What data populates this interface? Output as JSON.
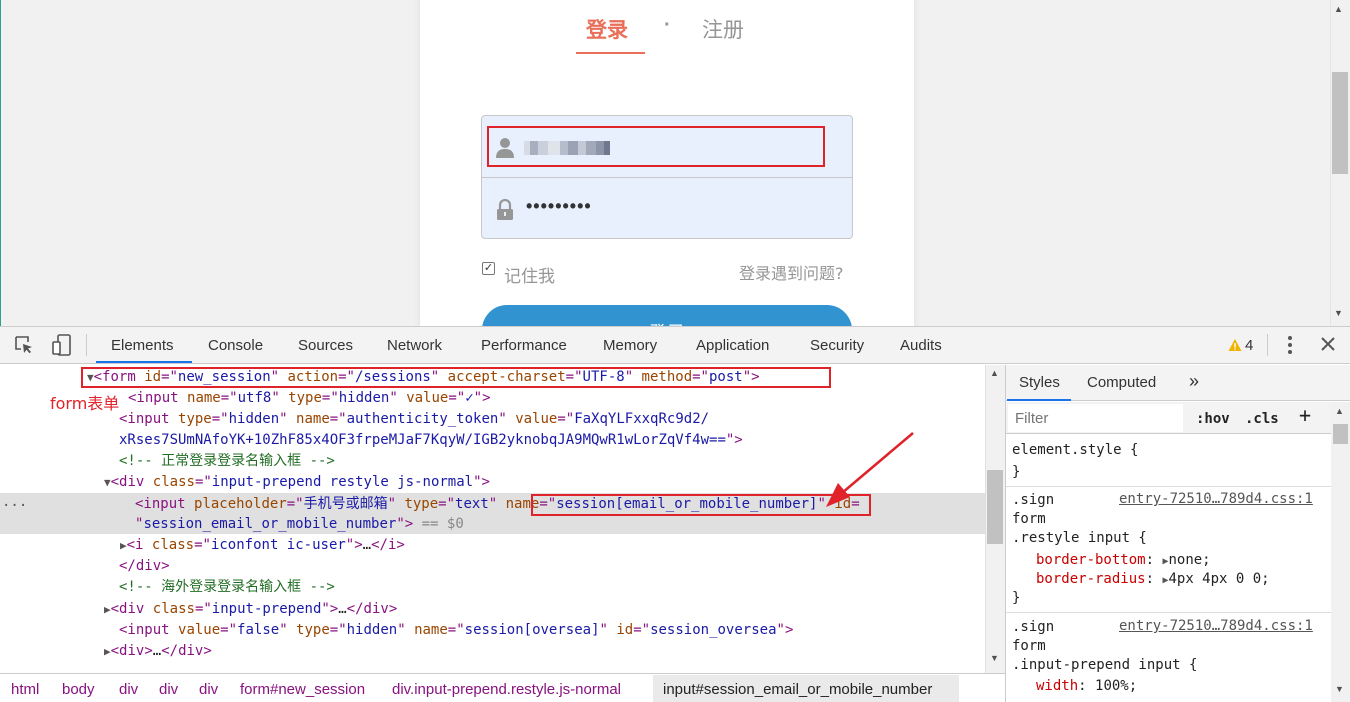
{
  "page": {
    "tab_login": "登录",
    "tab_dot": "·",
    "tab_register": "注册",
    "password_mask": "•••••••••",
    "remember_check": "✓",
    "remember_label": "记住我",
    "trouble_link": "登录遇到问题?",
    "login_button": "登录",
    "scroll_up": "▲",
    "scroll_down": "▼"
  },
  "devtools": {
    "tabs": [
      "Elements",
      "Console",
      "Sources",
      "Network",
      "Performance",
      "Memory",
      "Application",
      "Security",
      "Audits"
    ],
    "warning_count": "4"
  },
  "elements": {
    "lines": [
      {
        "indent": "▼",
        "parts": [
          [
            "tag",
            "<form "
          ],
          [
            "an",
            "id"
          ],
          [
            "tag",
            "=\""
          ],
          [
            "av",
            "new_session"
          ],
          [
            "tag",
            "\" "
          ],
          [
            "an",
            "action"
          ],
          [
            "tag",
            "=\""
          ],
          [
            "av",
            "/sessions"
          ],
          [
            "tag",
            "\" "
          ],
          [
            "an",
            "accept-charset"
          ],
          [
            "tag",
            "=\""
          ],
          [
            "av",
            "UTF-8"
          ],
          [
            "tag",
            "\" "
          ],
          [
            "an",
            "method"
          ],
          [
            "tag",
            "=\""
          ],
          [
            "av",
            "post"
          ],
          [
            "tag",
            "\">"
          ]
        ]
      },
      {
        "indent": "",
        "parts": [
          [
            "tag",
            "<input "
          ],
          [
            "an",
            "name"
          ],
          [
            "tag",
            "=\""
          ],
          [
            "av",
            "utf8"
          ],
          [
            "tag",
            "\" "
          ],
          [
            "an",
            "type"
          ],
          [
            "tag",
            "=\""
          ],
          [
            "av",
            "hidden"
          ],
          [
            "tag",
            "\" "
          ],
          [
            "an",
            "value"
          ],
          [
            "tag",
            "=\""
          ],
          [
            "av",
            "✓"
          ],
          [
            "tag",
            "\">"
          ]
        ]
      },
      {
        "indent": "",
        "parts": [
          [
            "tag",
            "<input "
          ],
          [
            "an",
            "type"
          ],
          [
            "tag",
            "=\""
          ],
          [
            "av",
            "hidden"
          ],
          [
            "tag",
            "\" "
          ],
          [
            "an",
            "name"
          ],
          [
            "tag",
            "=\""
          ],
          [
            "av",
            "authenticity_token"
          ],
          [
            "tag",
            "\" "
          ],
          [
            "an",
            "value"
          ],
          [
            "tag",
            "=\""
          ],
          [
            "av",
            "FaXqYLFxxqRc9d2/"
          ]
        ]
      },
      {
        "indent": "",
        "parts": [
          [
            "av",
            "xRses7SUmNAfoYK+10ZhF85x4OF3frpeMJaF7KqyW/IGB2yknobqJA9MQwR1wLorZqVf4w=="
          ],
          [
            "tag",
            "\">"
          ]
        ]
      },
      {
        "indent": "",
        "parts": [
          [
            "cm",
            "<!-- 正常登录登录名输入框 -->"
          ]
        ]
      },
      {
        "indent": "▼",
        "parts": [
          [
            "tag",
            "<div "
          ],
          [
            "an",
            "class"
          ],
          [
            "tag",
            "=\""
          ],
          [
            "av",
            "input-prepend restyle js-normal"
          ],
          [
            "tag",
            "\">"
          ]
        ]
      },
      {
        "indent": "",
        "parts": [
          [
            "tag",
            "<input "
          ],
          [
            "an",
            "placeholder"
          ],
          [
            "tag",
            "=\""
          ],
          [
            "av",
            "手机号或邮箱"
          ],
          [
            "tag",
            "\" "
          ],
          [
            "an",
            "type"
          ],
          [
            "tag",
            "=\""
          ],
          [
            "av",
            "text"
          ],
          [
            "tag",
            "\" "
          ],
          [
            "an",
            "name"
          ],
          [
            "tag",
            "=\""
          ],
          [
            "av",
            "session[email_or_mobile_number]"
          ],
          [
            "tag",
            "\" "
          ],
          [
            "an",
            "id"
          ],
          [
            "tag",
            "="
          ]
        ]
      },
      {
        "indent": "",
        "parts": [
          [
            "tag",
            "\""
          ],
          [
            "av",
            "session_email_or_mobile_number"
          ],
          [
            "tag",
            "\">"
          ],
          [
            "gray",
            " == "
          ],
          [
            "gray",
            "$0"
          ]
        ]
      },
      {
        "indent": "▶",
        "parts": [
          [
            "tag",
            "<i "
          ],
          [
            "an",
            "class"
          ],
          [
            "tag",
            "=\""
          ],
          [
            "av",
            "iconfont ic-user"
          ],
          [
            "tag",
            "\">"
          ],
          [
            "tx",
            "…"
          ],
          [
            "tag",
            "</i>"
          ]
        ]
      },
      {
        "indent": "",
        "parts": [
          [
            "tag",
            "</div>"
          ]
        ]
      },
      {
        "indent": "",
        "parts": [
          [
            "cm",
            "<!-- 海外登录登录名输入框 -->"
          ]
        ]
      },
      {
        "indent": "▶",
        "parts": [
          [
            "tag",
            "<div "
          ],
          [
            "an",
            "class"
          ],
          [
            "tag",
            "=\""
          ],
          [
            "av",
            "input-prepend"
          ],
          [
            "tag",
            "\">"
          ],
          [
            "tx",
            "…"
          ],
          [
            "tag",
            "</div>"
          ]
        ]
      },
      {
        "indent": "",
        "parts": [
          [
            "tag",
            "<input "
          ],
          [
            "an",
            "value"
          ],
          [
            "tag",
            "=\""
          ],
          [
            "av",
            "false"
          ],
          [
            "tag",
            "\" "
          ],
          [
            "an",
            "type"
          ],
          [
            "tag",
            "=\""
          ],
          [
            "av",
            "hidden"
          ],
          [
            "tag",
            "\" "
          ],
          [
            "an",
            "name"
          ],
          [
            "tag",
            "=\""
          ],
          [
            "av",
            "session[oversea]"
          ],
          [
            "tag",
            "\" "
          ],
          [
            "an",
            "id"
          ],
          [
            "tag",
            "=\""
          ],
          [
            "av",
            "session_oversea"
          ],
          [
            "tag",
            "\">"
          ]
        ]
      },
      {
        "indent": "▶",
        "parts": [
          [
            "tag",
            "<div>"
          ],
          [
            "tx",
            "…"
          ],
          [
            "tag",
            "</div>"
          ]
        ]
      }
    ],
    "selected_marker": "...",
    "annotation": "form表单"
  },
  "breadcrumb": [
    "html",
    "body",
    "div",
    "div",
    "div",
    "form#new_session",
    "div.input-prepend.restyle.js-normal",
    "input#session_email_or_mobile_number"
  ],
  "styles": {
    "tabs": [
      "Styles",
      "Computed",
      "»"
    ],
    "filter_placeholder": "Filter",
    "hov": ":hov",
    "cls": ".cls",
    "plus": "+",
    "element_style_open": "element.style {",
    "close_brace": "}",
    "rule1_sel1": ".sign",
    "rule1_source": "entry-72510…789d4.css:1",
    "rule1_sel2": "form",
    "rule1_sel3": ".restyle input {",
    "rule1_p1_name": "border-bottom",
    "rule1_p1_val": "none;",
    "rule1_p2_name": "border-radius",
    "rule1_p2_val": "4px 4px 0 0;",
    "rule2_sel1": ".sign",
    "rule2_source": "entry-72510…789d4.css:1",
    "rule2_sel2": "form",
    "rule2_sel3": ".input-prepend input {",
    "rule2_p1_name": "width",
    "rule2_p1_val": "100%;"
  }
}
